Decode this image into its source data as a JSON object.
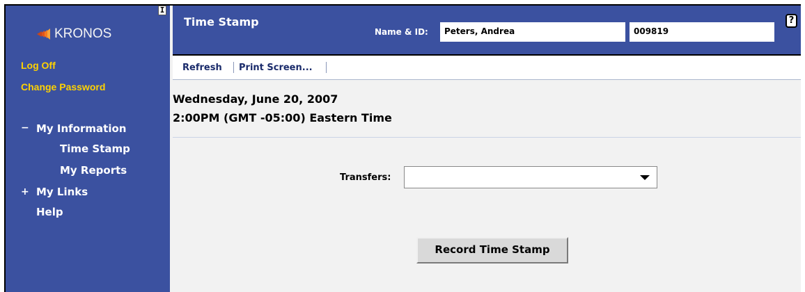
{
  "brand": {
    "logo_text": "KRONOS",
    "collapse_glyph": "I"
  },
  "sidebar": {
    "log_off": "Log Off",
    "change_password": "Change Password",
    "nav": [
      {
        "sign": "−",
        "label": "My Information"
      },
      {
        "sign": "",
        "label": "Time Stamp"
      },
      {
        "sign": "",
        "label": "My Reports"
      },
      {
        "sign": "+",
        "label": "My Links"
      },
      {
        "sign": "",
        "label": "Help"
      }
    ]
  },
  "header": {
    "title": "Time Stamp",
    "name_id_label": "Name & ID:",
    "name_value": "Peters, Andrea",
    "id_value": "009819",
    "help_glyph": "?"
  },
  "toolbar": {
    "refresh": "Refresh",
    "print_screen": "Print Screen..."
  },
  "main": {
    "date": "Wednesday, June 20, 2007",
    "time": "2:00PM (GMT -05:00) Eastern Time",
    "transfers_label": "Transfers:",
    "transfers_value": "",
    "record_button": "Record Time Stamp"
  },
  "colors": {
    "nav_blue": "#3b51a0",
    "link_yellow": "#ffd200",
    "logo_orange": "#f47a20"
  },
  "icons": [
    "kronos-logo-icon",
    "collapse-icon",
    "help-icon",
    "dropdown-arrow-icon"
  ]
}
